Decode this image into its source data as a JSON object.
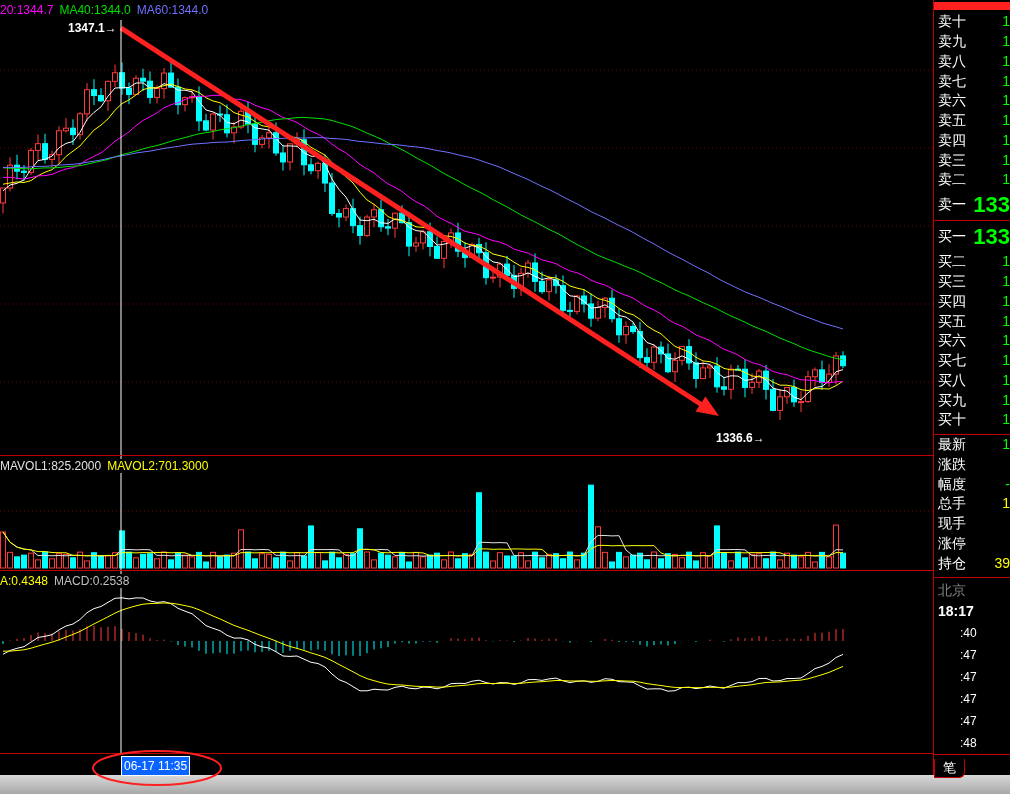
{
  "price_panel": {
    "legend": [
      {
        "text": "20:1344.7",
        "color": "#ff00ff"
      },
      {
        "text": "MA40:1344.0",
        "color": "#00e000"
      },
      {
        "text": "MA60:1344.0",
        "color": "#7070ff"
      }
    ],
    "high_label": "1347.1→",
    "low_label": "1336.6→"
  },
  "volume_panel": {
    "legend": [
      {
        "text": "MAVOL1:825.2000",
        "color": "#e0e0e0"
      },
      {
        "text": "MAVOL2:701.3000",
        "color": "#ffff00"
      }
    ]
  },
  "macd_panel": {
    "legend": [
      {
        "text": "A:0.4348",
        "color": "#ffff00"
      },
      {
        "text": "MACD:0.2538",
        "color": "#c0c0c0"
      }
    ]
  },
  "crosshair_date": "06-17 11:35",
  "order_book": {
    "asks": [
      {
        "label": "卖十",
        "value": "1"
      },
      {
        "label": "卖九",
        "value": "1"
      },
      {
        "label": "卖八",
        "value": "1"
      },
      {
        "label": "卖七",
        "value": "1"
      },
      {
        "label": "卖六",
        "value": "1"
      },
      {
        "label": "卖五",
        "value": "1"
      },
      {
        "label": "卖四",
        "value": "1"
      },
      {
        "label": "卖三",
        "value": "1"
      },
      {
        "label": "卖二",
        "value": "1"
      },
      {
        "label": "卖一",
        "value": "133",
        "kind": "best"
      }
    ],
    "bids": [
      {
        "label": "买一",
        "value": "133",
        "kind": "best"
      },
      {
        "label": "买二",
        "value": "1"
      },
      {
        "label": "买三",
        "value": "1"
      },
      {
        "label": "买四",
        "value": "1"
      },
      {
        "label": "买五",
        "value": "1"
      },
      {
        "label": "买六",
        "value": "1"
      },
      {
        "label": "买七",
        "value": "1"
      },
      {
        "label": "买八",
        "value": "1"
      },
      {
        "label": "买九",
        "value": "1"
      },
      {
        "label": "买十",
        "value": "1"
      }
    ]
  },
  "quote": [
    {
      "label": "最新",
      "value": "1",
      "color": "#00ff00"
    },
    {
      "label": "涨跌"
    },
    {
      "label": "幅度",
      "value": "-",
      "color": "#00ff00"
    },
    {
      "label": "总手",
      "value": "1",
      "color": "#ffff00"
    },
    {
      "label": "现手"
    },
    {
      "label": "涨停"
    },
    {
      "label": "持仓",
      "value": "39",
      "color": "#ffff00"
    }
  ],
  "ticks": {
    "city": "北京",
    "time": "18:17",
    "rows": [
      ":40",
      ":47",
      ":47",
      ":47",
      ":47",
      ":48"
    ],
    "tab": "笔"
  }
}
